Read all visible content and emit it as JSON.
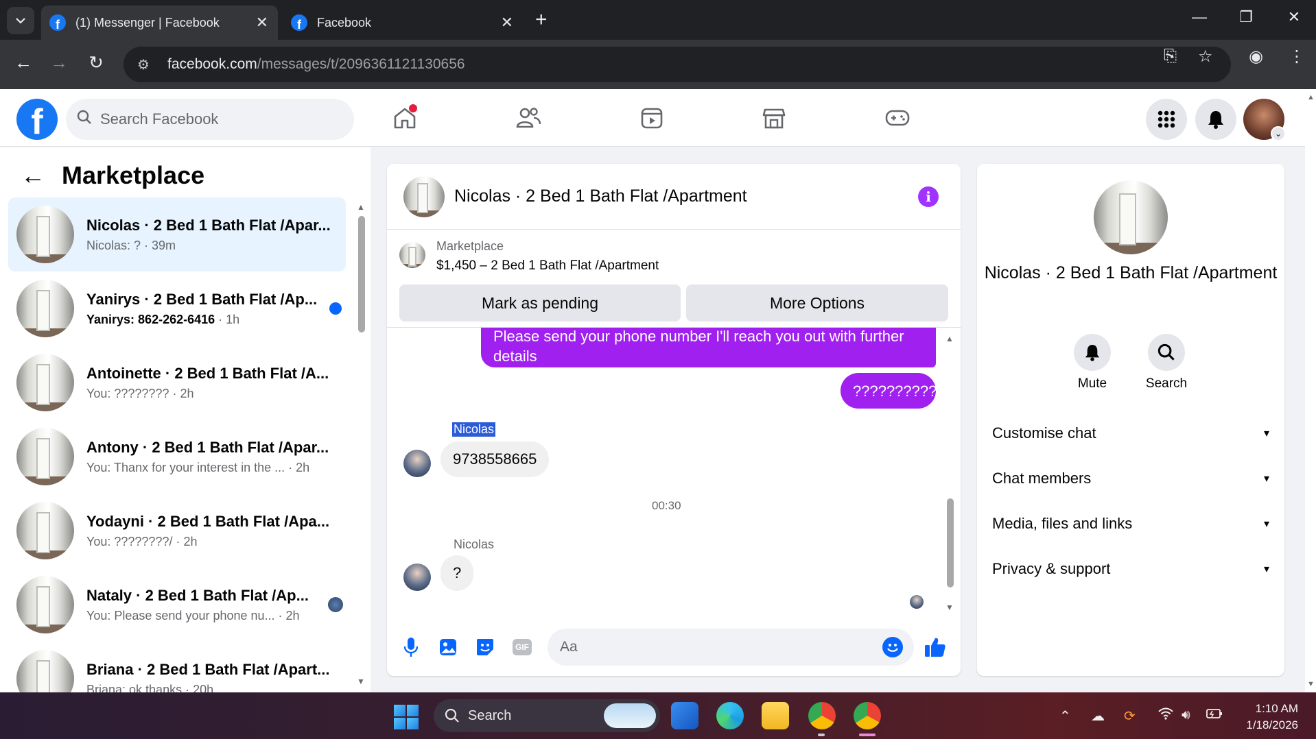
{
  "browser": {
    "tabs": [
      {
        "title": "(1) Messenger | Facebook",
        "active": true
      },
      {
        "title": "Facebook",
        "active": false
      }
    ],
    "url_host": "facebook.com",
    "url_path": "/messages/t/2096361121130656"
  },
  "fb": {
    "search_placeholder": "Search Facebook",
    "nav_icons": [
      "home-icon",
      "friends-icon",
      "video-icon",
      "marketplace-icon",
      "gaming-icon"
    ],
    "brand_color": "#1877f2"
  },
  "left": {
    "title": "Marketplace",
    "conversations": [
      {
        "title": "Nicolas · 2 Bed 1 Bath Flat /Apar...",
        "sub": "Nicolas: ? · 39m",
        "unread": false,
        "selected": true
      },
      {
        "title": "Yanirys · 2 Bed 1 Bath Flat /Ap...",
        "sub": "Yanirys: 862-262-6416",
        "time": " · 1h",
        "unread": true
      },
      {
        "title": "Antoinette · 2 Bed 1 Bath Flat /A...",
        "sub": "You: ???????? · 2h",
        "unread": false
      },
      {
        "title": "Antony · 2 Bed 1 Bath Flat /Apar...",
        "sub": "You: Thanx for your interest in the ...  · 2h",
        "unread": false
      },
      {
        "title": "Yodayni · 2 Bed 1 Bath Flat /Apa...",
        "sub": "You: ????????/ · 2h",
        "unread": false
      },
      {
        "title": "Nataly · 2 Bed 1 Bath Flat /Ap...",
        "sub": "You: Please send your phone nu...  · 2h",
        "unread": false
      },
      {
        "title": "Briana · 2 Bed 1 Bath Flat /Apart...",
        "sub": "Briana: ok thanks · 20h",
        "unread": false
      }
    ]
  },
  "chat": {
    "name": "Nicolas · 2 Bed 1 Bath Flat /Apartment",
    "marketplace_label": "Marketplace",
    "listing": "$1,450 – 2 Bed 1 Bath Flat /Apartment",
    "btn_pending": "Mark as pending",
    "btn_more": "More Options",
    "messages": {
      "out1": "Please send your phone number  I'll reach you out with further details",
      "out2": "??????????",
      "sender1": "Nicolas",
      "in1": "9738558665",
      "timestamp": "00:30",
      "sender2": "Nicolas",
      "in2": "?"
    },
    "composer_placeholder": "Aa",
    "bubble_color": "#a020f0"
  },
  "info_panel": {
    "name": "Nicolas · 2 Bed 1 Bath Flat /Apartment",
    "actions": [
      {
        "label": "Mute",
        "icon": "bell-icon"
      },
      {
        "label": "Search",
        "icon": "search-icon"
      }
    ],
    "sections": [
      "Customise chat",
      "Chat members",
      "Media, files and links",
      "Privacy & support"
    ]
  },
  "taskbar": {
    "search_label": "Search",
    "time": "1:10 AM",
    "date": "1/18/2026"
  }
}
